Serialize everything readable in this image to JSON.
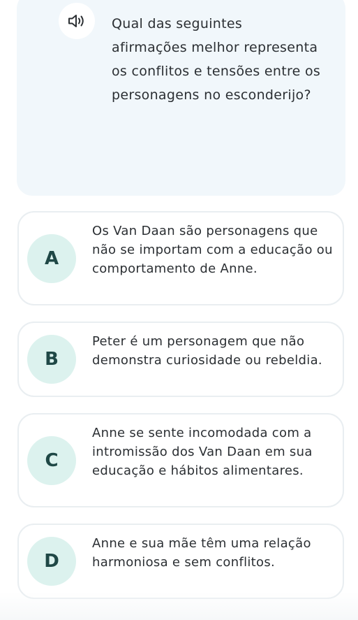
{
  "question": {
    "audio_icon": "speaker-icon",
    "text": "Qual das seguintes afirmações melhor representa os conflitos e tensões entre os personagens no esconderijo?"
  },
  "options": [
    {
      "letter": "A",
      "text": "Os Van Daan são personagens que não se importam com a educação ou comportamento de Anne."
    },
    {
      "letter": "B",
      "text": "Peter é um personagem que não demonstra curiosidade ou rebeldia."
    },
    {
      "letter": "C",
      "text": "Anne se sente incomodada com a intromissão dos Van Daan em sua educação e hábitos alimentares."
    },
    {
      "letter": "D",
      "text": "Anne e sua mãe têm uma relação harmoniosa e sem conflitos."
    }
  ],
  "colors": {
    "question_bg": "#f1f7fb",
    "letter_bg": "#dcf2ee",
    "letter_text": "#1f4846",
    "border": "#e9eef1",
    "text": "#2b2f33"
  }
}
